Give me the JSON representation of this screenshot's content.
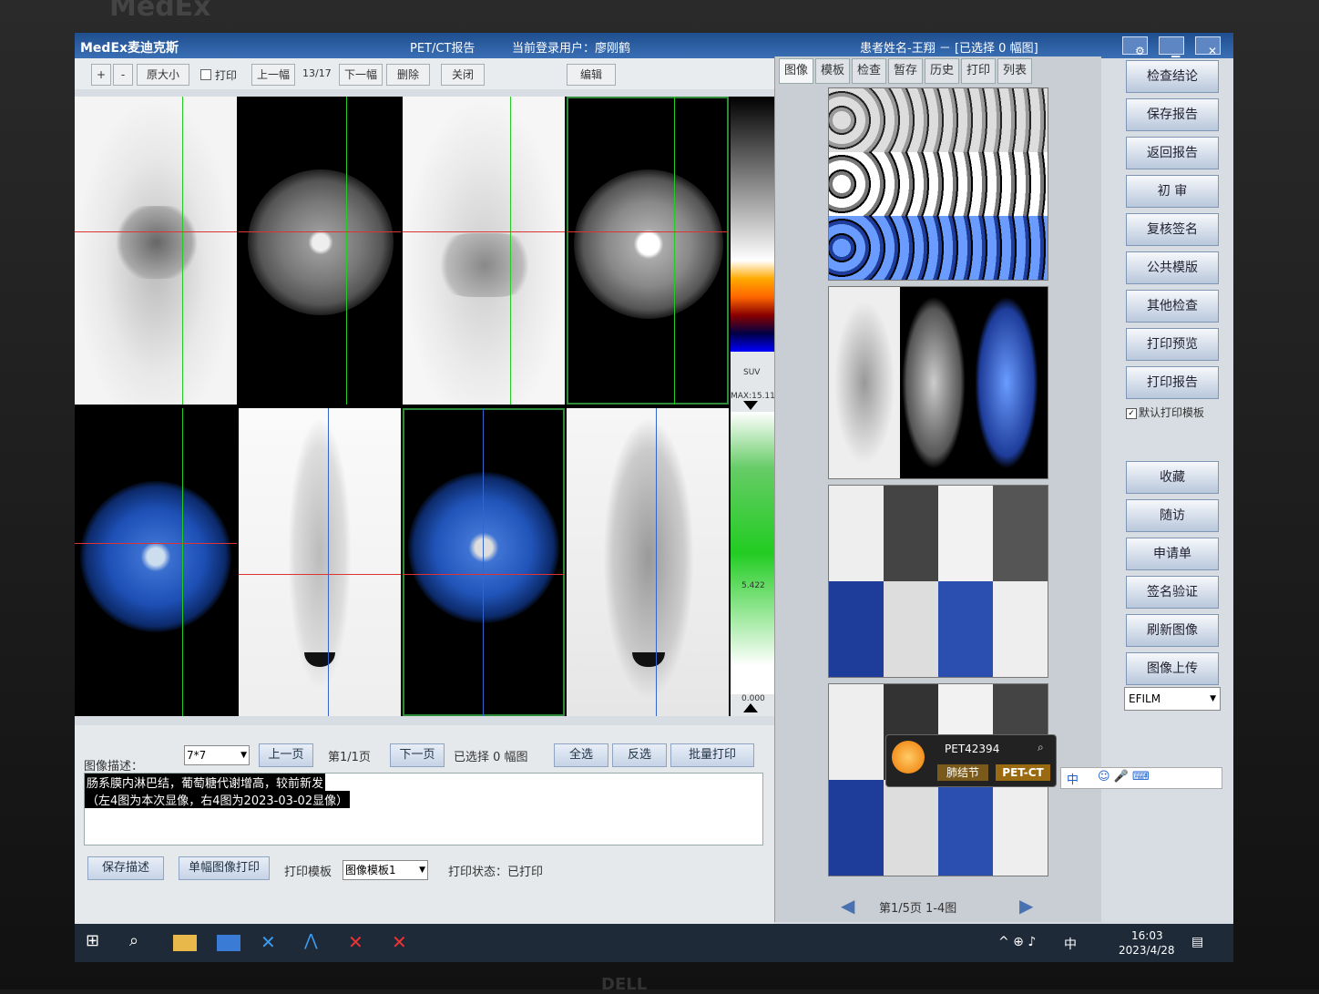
{
  "monitor": {
    "brand_top": "MedEx",
    "brand_bottom": "DELL"
  },
  "titlebar": {
    "logo": "MedEx麦迪克斯",
    "title": "PET/CT报告",
    "user_label": "当前登录用户：廖刚鹤",
    "patient_info": "患者姓名-王翔 － [已选择 0 幅图]",
    "settings_icon": "gear-icon",
    "minimize_icon": "minimize-icon",
    "close_icon": "close-icon"
  },
  "toolbar": {
    "zoom_in": "+",
    "zoom_out": "-",
    "original_size": "原大小",
    "print_checkbox": "打印",
    "prev_frame": "上一幅",
    "frame_counter": "13/17",
    "next_frame": "下一幅",
    "delete": "删除",
    "close": "关闭",
    "edit": "编辑"
  },
  "colorbar": {
    "suv_label": "SUV",
    "max_label": "MAX:15.11",
    "mid_value": "5.422",
    "min_value": "0.000"
  },
  "bottom": {
    "layout_select": "7*7",
    "prev_page": "上一页",
    "page_info": "第1/1页",
    "next_page": "下一页",
    "selected_info": "已选择 0 幅图",
    "select_all": "全选",
    "invert": "反选",
    "batch_print": "批量打印",
    "desc_label": "图像描述：",
    "desc_line1": "肠系膜内淋巴结，葡萄糖代谢增高，较前新发",
    "desc_line2": "（左4图为本次显像，右4图为2023-03-02显像）",
    "save_desc": "保存描述",
    "single_print": "单幅图像打印",
    "print_template_label": "打印模板",
    "print_template_value": "图像模板1",
    "print_status": "打印状态：已打印"
  },
  "right_panel": {
    "tabs": [
      "图像",
      "模板",
      "检查",
      "暂存",
      "历史",
      "打印",
      "列表"
    ],
    "pager_text": "第1/5页 1-4图",
    "popup_id": "PET42394",
    "popup_tag1": "肺结节",
    "popup_tag2": "PET-CT",
    "ime_label": "中"
  },
  "side_buttons": {
    "items": [
      "检查结论",
      "保存报告",
      "返回报告",
      "初 审",
      "复核签名",
      "公共模版",
      "其他检查",
      "打印预览",
      "打印报告"
    ],
    "default_template": "默认打印模板",
    "items2": [
      "收藏",
      "随访",
      "申请单",
      "签名验证",
      "刷新图像",
      "图像上传"
    ],
    "film_select": "EFILM"
  },
  "taskbar": {
    "time": "16:03",
    "date": "2023/4/28",
    "ime": "中"
  }
}
